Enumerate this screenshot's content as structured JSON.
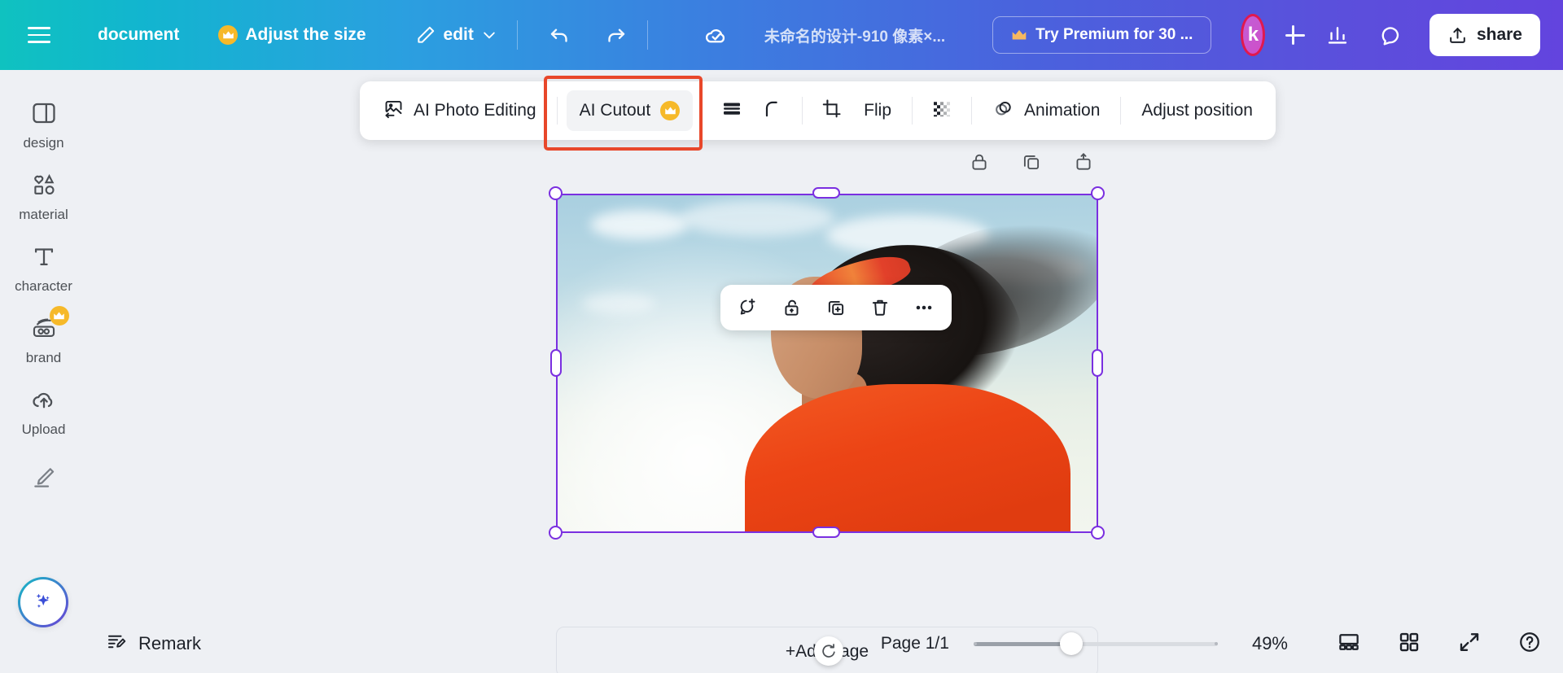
{
  "topbar": {
    "menu_icon": "hamburger-icon",
    "document_label": "document",
    "adjust_size_label": "Adjust the size",
    "edit_label": "edit",
    "undo_icon": "undo-icon",
    "redo_icon": "redo-icon",
    "saved_icon": "cloud-check-icon",
    "filename": "未命名的设计-910 像素×...",
    "premium_label": "Try Premium for 30 ...",
    "avatar_initial": "k",
    "add_icon": "plus-icon",
    "insights_icon": "bar-chart-icon",
    "comments_icon": "chat-bubble-icon",
    "share_label": "share",
    "share_icon": "upload-share-icon"
  },
  "sidebar": {
    "items": [
      {
        "label": "design",
        "icon": "layout-panel-icon",
        "premium": false
      },
      {
        "label": "material",
        "icon": "shapes-icon",
        "premium": false
      },
      {
        "label": "character",
        "icon": "text-t-icon",
        "premium": false
      },
      {
        "label": "brand",
        "icon": "brand-kit-icon",
        "premium": true
      },
      {
        "label": "Upload",
        "icon": "cloud-upload-icon",
        "premium": false
      }
    ],
    "draw_icon": "pen-draw-icon",
    "magic_icon": "magic-sparkle-icon"
  },
  "image_toolbar": {
    "photo_editing_label": "AI Photo Editing",
    "photo_editing_icon": "image-edit-icon",
    "cutout_label": "AI Cutout",
    "cutout_premium_icon": "crown-icon",
    "layers_icon": "stack-lines-icon",
    "corner_radius_icon": "corner-curve-icon",
    "crop_icon": "crop-icon",
    "flip_label": "Flip",
    "transparency_icon": "checkerboard-transparency-icon",
    "animation_label": "Animation",
    "animation_icon": "animation-circles-icon",
    "adjust_position_label": "Adjust position",
    "highlight_color": "#e8472a",
    "highlighted_item": "AI Cutout"
  },
  "page_header_icons": [
    {
      "name": "lock-icon"
    },
    {
      "name": "duplicate-page-icon"
    },
    {
      "name": "add-page-icon"
    }
  ],
  "context_toolbar": {
    "items": [
      {
        "name": "comment-add-icon"
      },
      {
        "name": "unlock-icon"
      },
      {
        "name": "duplicate-icon"
      },
      {
        "name": "delete-trash-icon"
      },
      {
        "name": "more-options-icon"
      }
    ]
  },
  "canvas": {
    "add_page_label": "+Add page",
    "rotate_icon": "rotate-handle-icon",
    "selection_color": "#7a2fe0"
  },
  "bottombar": {
    "remark_label": "Remark",
    "remark_icon": "notes-pen-icon",
    "page_indicator": "Page 1/1",
    "zoom_value": "49%",
    "zoom_percent": 49,
    "slider_position_percent": 40,
    "icons": [
      {
        "name": "page-view-icon"
      },
      {
        "name": "grid-view-icon"
      },
      {
        "name": "fullscreen-icon"
      },
      {
        "name": "help-icon"
      }
    ]
  }
}
